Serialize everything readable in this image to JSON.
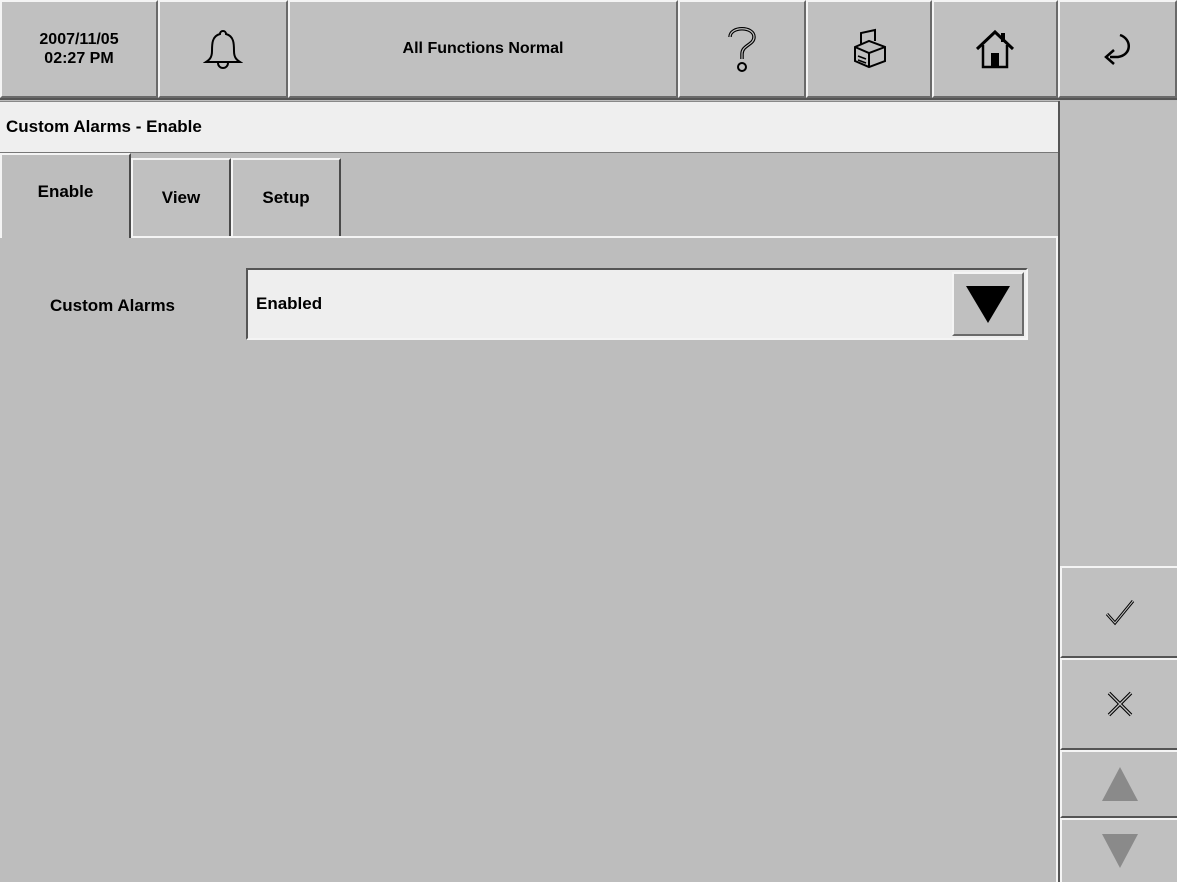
{
  "header": {
    "date": "2007/11/05",
    "time": "02:27 PM",
    "status": "All Functions Normal",
    "icons": [
      "bell-icon",
      "help-icon",
      "printer-icon",
      "home-icon",
      "back-arrow-icon"
    ]
  },
  "page": {
    "title": "Custom Alarms - Enable"
  },
  "tabs": [
    {
      "label": "Enable",
      "active": true
    },
    {
      "label": "View",
      "active": false
    },
    {
      "label": "Setup",
      "active": false
    }
  ],
  "form": {
    "custom_alarms_label": "Custom Alarms",
    "custom_alarms_value": "Enabled"
  },
  "sidebar": {
    "icons": [
      "checkmark-icon",
      "cancel-x-icon",
      "scroll-up-icon",
      "scroll-down-icon"
    ]
  }
}
